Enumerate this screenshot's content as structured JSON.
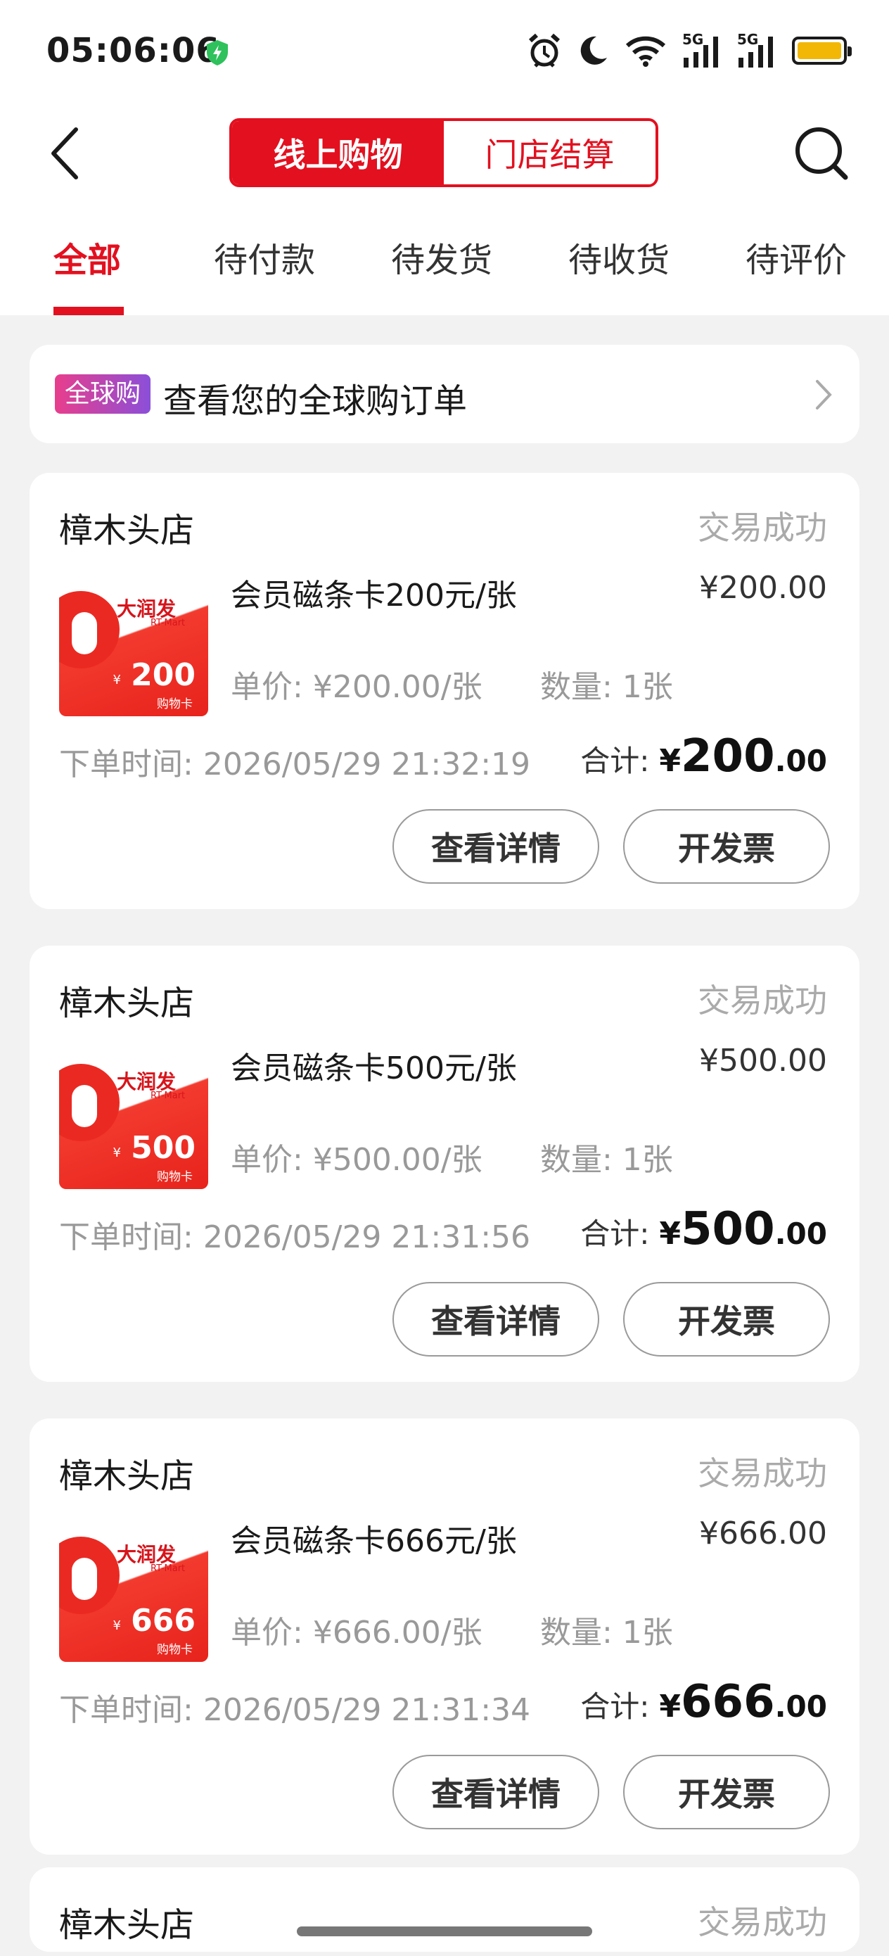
{
  "status_bar": {
    "time": "05:06:06",
    "network_1": "5G",
    "network_2": "5G",
    "icons": [
      "shield-charge-icon",
      "alarm-icon",
      "moon-icon",
      "wifi-icon",
      "signal-icon",
      "signal-icon",
      "battery-icon"
    ],
    "battery_color": "#f2b705"
  },
  "header": {
    "segments": [
      {
        "label": "线上购物",
        "active": true
      },
      {
        "label": "门店结算",
        "active": false
      }
    ],
    "accent": "#e3101f"
  },
  "tabs": [
    "全部",
    "待付款",
    "待发货",
    "待收货",
    "待评价"
  ],
  "global": {
    "badge": "全球购",
    "text": "查看您的全球购订单"
  },
  "orders": [
    {
      "store": "樟木头店",
      "status": "交易成功",
      "product": "会员磁条卡200元/张",
      "price": "¥200.00",
      "unit_label": "单价:",
      "unit_price": "¥200.00/张",
      "qty": "数量: 1张",
      "time_label": "下单时间:",
      "time": "2026/05/29 21:32:19",
      "total_label": "合计:",
      "total_cur": "¥",
      "total_int": "200",
      "total_dec": ".00",
      "card_value": "200",
      "card_cur": "¥",
      "card_sub": "购物卡",
      "card_logo": "大润发",
      "card_logo_sub": "RT-Mart",
      "btn_detail": "查看详情",
      "btn_invoice": "开发票"
    },
    {
      "store": "樟木头店",
      "status": "交易成功",
      "product": "会员磁条卡500元/张",
      "price": "¥500.00",
      "unit_label": "单价:",
      "unit_price": "¥500.00/张",
      "qty": "数量: 1张",
      "time_label": "下单时间:",
      "time": "2026/05/29 21:31:56",
      "total_label": "合计:",
      "total_cur": "¥",
      "total_int": "500",
      "total_dec": ".00",
      "card_value": "500",
      "card_cur": "¥",
      "card_sub": "购物卡",
      "card_logo": "大润发",
      "card_logo_sub": "RT-Mart",
      "btn_detail": "查看详情",
      "btn_invoice": "开发票"
    },
    {
      "store": "樟木头店",
      "status": "交易成功",
      "product": "会员磁条卡666元/张",
      "price": "¥666.00",
      "unit_label": "单价:",
      "unit_price": "¥666.00/张",
      "qty": "数量: 1张",
      "time_label": "下单时间:",
      "time": "2026/05/29 21:31:34",
      "total_label": "合计:",
      "total_cur": "¥",
      "total_int": "666",
      "total_dec": ".00",
      "card_value": "666",
      "card_cur": "¥",
      "card_sub": "购物卡",
      "card_logo": "大润发",
      "card_logo_sub": "RT-Mart",
      "btn_detail": "查看详情",
      "btn_invoice": "开发票"
    }
  ],
  "partial_order": {
    "store": "樟木头店",
    "status": "交易成功"
  }
}
